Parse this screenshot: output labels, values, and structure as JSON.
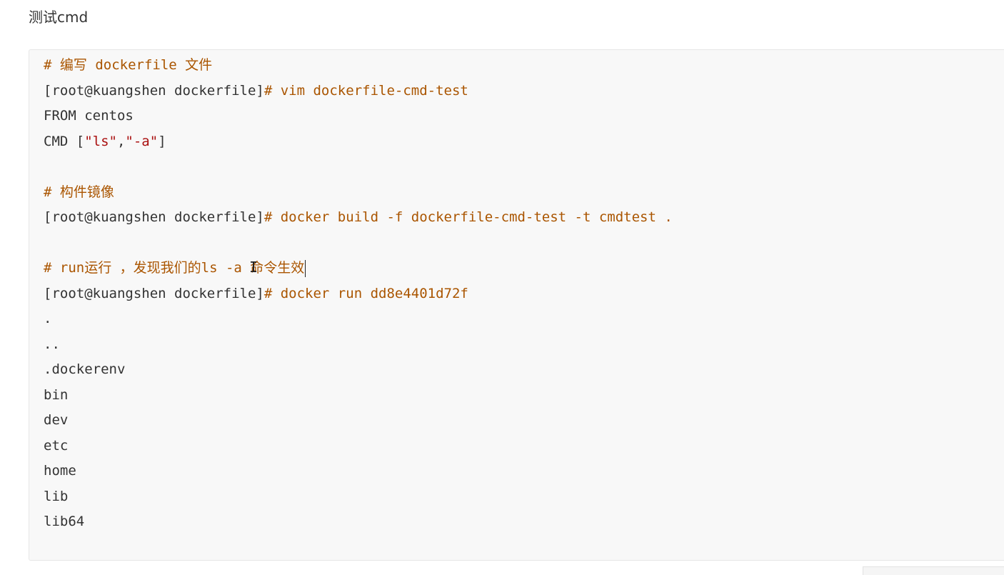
{
  "heading": "测试cmd",
  "code": {
    "lines": [
      {
        "parts": [
          {
            "t": "# 编写 dockerfile 文件",
            "c": "comment"
          }
        ]
      },
      {
        "parts": [
          {
            "t": "[root@kuangshen dockerfile]",
            "c": ""
          },
          {
            "t": "# vim dockerfile-cmd-test",
            "c": "cmd"
          }
        ]
      },
      {
        "parts": [
          {
            "t": "FROM centos",
            "c": ""
          }
        ]
      },
      {
        "parts": [
          {
            "t": "CMD [",
            "c": ""
          },
          {
            "t": "\"ls\"",
            "c": "str"
          },
          {
            "t": ",",
            "c": ""
          },
          {
            "t": "\"-a\"",
            "c": "str"
          },
          {
            "t": "]",
            "c": ""
          }
        ]
      },
      {
        "parts": []
      },
      {
        "parts": [
          {
            "t": "# 构件镜像",
            "c": "comment"
          }
        ]
      },
      {
        "parts": [
          {
            "t": "[root@kuangshen dockerfile]",
            "c": ""
          },
          {
            "t": "# docker build -f dockerfile-cmd-test -t cmdtest .",
            "c": "cmd"
          }
        ]
      },
      {
        "parts": []
      },
      {
        "parts": [
          {
            "t": "# run运行 ，发现我们的ls -a 命令生效",
            "c": "comment"
          }
        ],
        "caret": true
      },
      {
        "parts": [
          {
            "t": "[root@kuangshen dockerfile]",
            "c": ""
          },
          {
            "t": "# docker run dd8e4401d72f",
            "c": "cmd"
          }
        ]
      },
      {
        "parts": [
          {
            "t": ".",
            "c": ""
          }
        ]
      },
      {
        "parts": [
          {
            "t": "..",
            "c": ""
          }
        ]
      },
      {
        "parts": [
          {
            "t": ".dockerenv",
            "c": ""
          }
        ]
      },
      {
        "parts": [
          {
            "t": "bin",
            "c": ""
          }
        ]
      },
      {
        "parts": [
          {
            "t": "dev",
            "c": ""
          }
        ]
      },
      {
        "parts": [
          {
            "t": "etc",
            "c": ""
          }
        ]
      },
      {
        "parts": [
          {
            "t": "home",
            "c": ""
          }
        ]
      },
      {
        "parts": [
          {
            "t": "lib",
            "c": ""
          }
        ]
      },
      {
        "parts": [
          {
            "t": "lib64",
            "c": ""
          }
        ]
      }
    ]
  }
}
